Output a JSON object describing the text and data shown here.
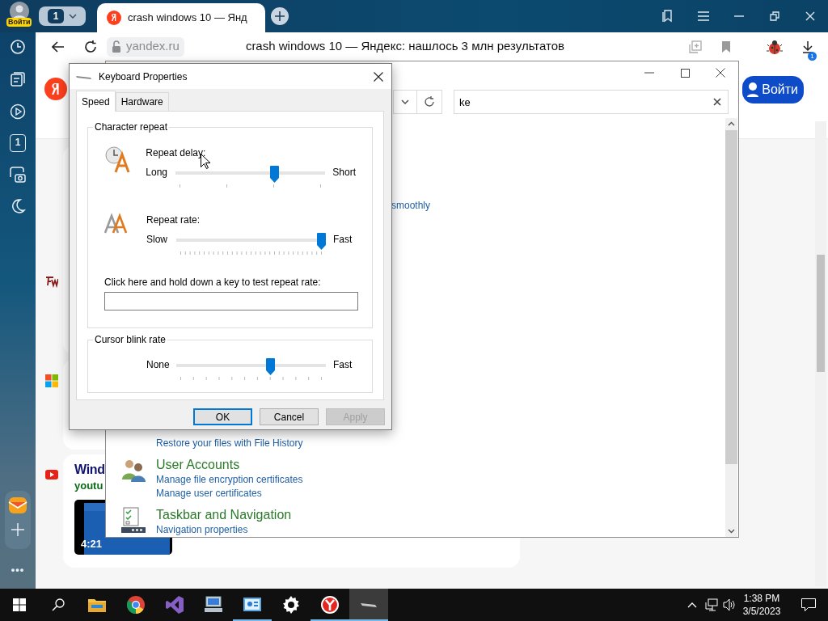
{
  "browser": {
    "profile_badge": "Войти",
    "tab_count": "1",
    "tabs": [
      {
        "title": "crash windows 10 — Янд",
        "selected": true
      }
    ],
    "address": {
      "domain": "yandex.ru",
      "page_title": "crash windows 10 — Яндекс: нашлось 3 млн результатов"
    },
    "downloads_badge": "1",
    "sidebar": {
      "counter": "1",
      "more": "•••"
    }
  },
  "page": {
    "login_button": "Войти",
    "results": [
      {
        "kind": "fw"
      },
      {
        "kind": "microsoft"
      },
      {
        "kind": "youtube",
        "title": "Wind",
        "source": "youtu",
        "duration": "4:21"
      }
    ]
  },
  "control_panel": {
    "search": {
      "value": "ke"
    },
    "link_fragment": "smoothly",
    "sections": [
      {
        "kind": "file-history",
        "links": [
          "Restore your files with File History"
        ]
      },
      {
        "kind": "users",
        "title": "User Accounts",
        "links": [
          "Manage file encryption certificates",
          "Manage user certificates"
        ]
      },
      {
        "kind": "taskbar",
        "title": "Taskbar and Navigation",
        "links": [
          "Navigation properties"
        ]
      }
    ]
  },
  "dialog": {
    "title": "Keyboard Properties",
    "tabs": [
      {
        "label": "Speed",
        "selected": true
      },
      {
        "label": "Hardware",
        "selected": false
      }
    ],
    "groups": [
      {
        "title": "Character repeat",
        "sliders": [
          {
            "kind": "delay",
            "label": "Repeat delay:",
            "min_label": "Long",
            "max_label": "Short",
            "level": 0.67
          },
          {
            "kind": "rate",
            "label": "Repeat rate:",
            "min_label": "Slow",
            "max_label": "Fast",
            "level": 1
          }
        ],
        "test_field": {
          "label": "Click here and hold down a key to test repeat rate:"
        }
      },
      {
        "title": "Cursor blink rate",
        "sliders": [
          {
            "kind": "blink",
            "min_label": "None",
            "max_label": "Fast",
            "level": 0.64
          }
        ]
      }
    ],
    "buttons": [
      {
        "label": "OK",
        "default": true,
        "disabled": false
      },
      {
        "label": "Cancel",
        "default": false,
        "disabled": false
      },
      {
        "label": "Apply",
        "default": false,
        "disabled": true
      }
    ]
  },
  "taskbar": {
    "apps": [
      {
        "kind": "explorer",
        "running": false,
        "selected": false
      },
      {
        "kind": "chrome",
        "running": false,
        "selected": false
      },
      {
        "kind": "visual-studio",
        "running": false,
        "selected": false
      },
      {
        "kind": "network",
        "running": false,
        "selected": false
      },
      {
        "kind": "control-panel",
        "running": true,
        "selected": false
      },
      {
        "kind": "settings",
        "running": false,
        "selected": false
      },
      {
        "kind": "yandex",
        "running": true,
        "selected": false
      },
      {
        "kind": "keyboard",
        "running": true,
        "selected": true
      }
    ],
    "time": "1:38 PM",
    "date": "3/5/2023"
  }
}
